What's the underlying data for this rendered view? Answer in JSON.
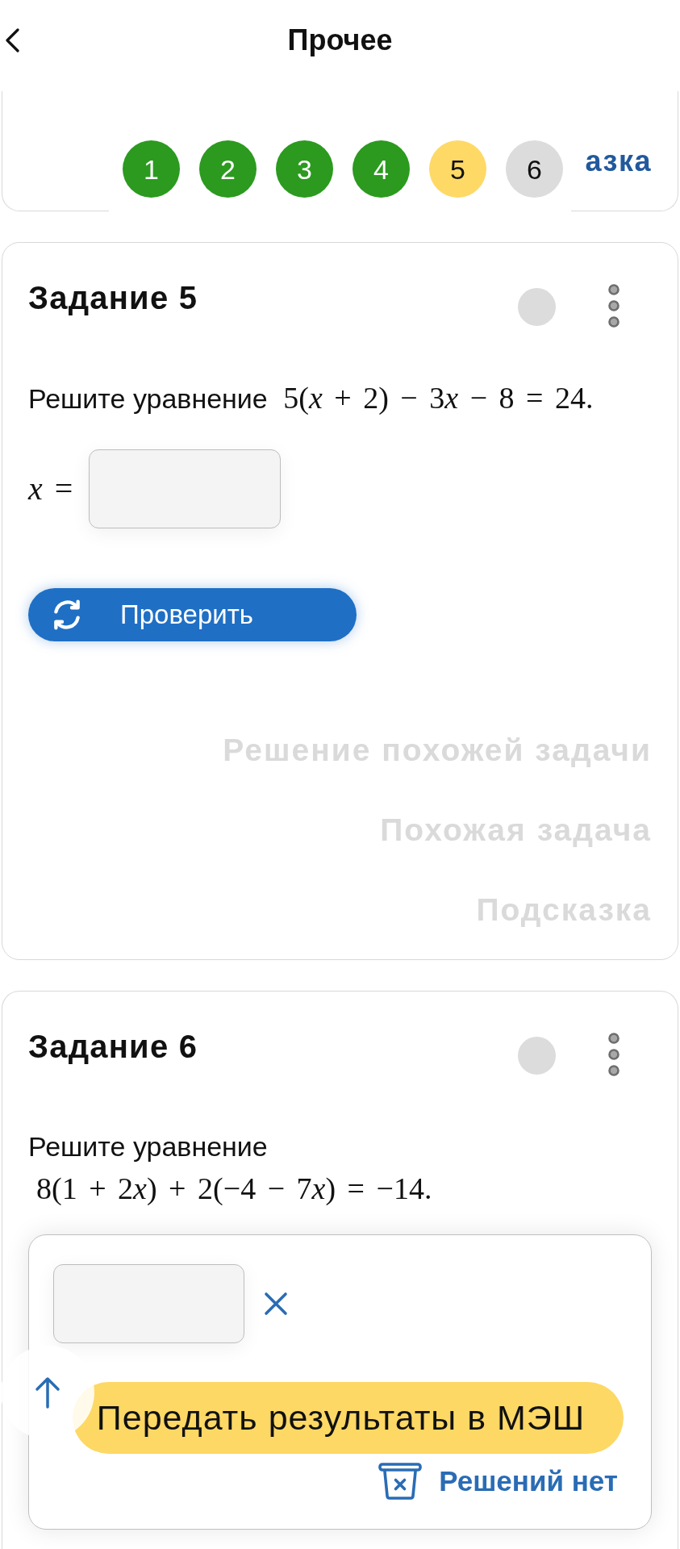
{
  "header": {
    "title": "Прочее"
  },
  "previous_task": {
    "links": [
      {
        "text": "азка",
        "disabled": false
      }
    ]
  },
  "steps": [
    {
      "label": "1",
      "color": "#2b9a1f"
    },
    {
      "label": "2",
      "color": "#2b9a1f"
    },
    {
      "label": "3",
      "color": "#2b9a1f"
    },
    {
      "label": "4",
      "color": "#2b9a1f"
    },
    {
      "label": "5",
      "color": "#fed966"
    },
    {
      "label": "6",
      "color": "#dcdcdc"
    }
  ],
  "tasks": [
    {
      "title": "Задание 5",
      "prompt": "Решите уравнение",
      "equation": "5(x + 2) − 3x − 8 = 24.",
      "answer": {
        "kind": "inline",
        "label": "x =",
        "check_button": "Проверить"
      },
      "links": [
        {
          "text": "Решение похожей задачи",
          "disabled": true
        },
        {
          "text": "Похожая задача",
          "disabled": true
        },
        {
          "text": "Подсказка",
          "disabled": true
        }
      ]
    },
    {
      "title": "Задание 6",
      "prompt": "Решите уравнение",
      "equation": "8(1 + 2x) + 2(−4 − 7x) = −14.",
      "answer": {
        "kind": "panel",
        "submit_button": "Передать результаты в МЭШ",
        "no_solutions_button": "Решений нет"
      }
    }
  ]
}
